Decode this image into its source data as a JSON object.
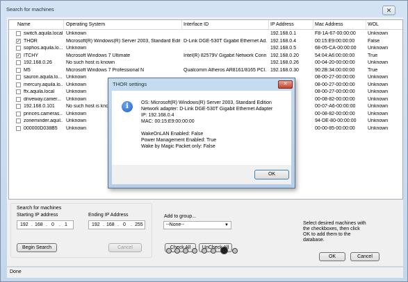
{
  "window": {
    "title": "Search for machines",
    "close_glyph": "✕"
  },
  "columns": [
    "Name",
    "Operating System",
    "Interface ID",
    "IP Address",
    "Mac Address",
    "WOL"
  ],
  "rows": [
    {
      "checked": false,
      "name": "switch.aquila.local",
      "os": "Unknown",
      "iface": "",
      "ip": "192.168.0.1",
      "mac": "F8-1A-67-00:00:00",
      "wol": "Unknown"
    },
    {
      "checked": true,
      "name": "THOR",
      "os": "Microsoft(R) Windows(R) Server 2003, Standard Edit...",
      "iface": "D-Link DGE-530T Gigabit Ethernet Ad...",
      "ip": "192.168.0.4",
      "mac": "00:15:E9:00:00:00",
      "wol": "False"
    },
    {
      "checked": false,
      "name": "sophos.aquila.lo...",
      "os": "Unknown",
      "iface": "",
      "ip": "192.168.0.5",
      "mac": "68-05-CA-00:00:00",
      "wol": "Unknown"
    },
    {
      "checked": true,
      "name": "ITCHY",
      "os": "Microsoft Windows 7 Ultimate",
      "iface": "Intel(R) 82579V Gigabit Network Conn...",
      "ip": "192.168.0.20",
      "mac": "54:04:A6:00:00:00",
      "wol": "True"
    },
    {
      "checked": false,
      "name": "192.168.0.26",
      "os": "No such host is known",
      "iface": "",
      "ip": "192.168.0.26",
      "mac": "00-04-20-00:00:00",
      "wol": "Unknown"
    },
    {
      "checked": false,
      "name": "M5",
      "os": "Microsoft Windows 7 Professional N",
      "iface": "Qualcomm Atheros AR8161/8165 PCI...",
      "ip": "192.168.0.30",
      "mac": "90:2B:34:00:00:00",
      "wol": "True"
    },
    {
      "checked": false,
      "name": "sauron.aquila.lo...",
      "os": "Unknown",
      "iface": "",
      "ip": "",
      "mac": "08-00-27-00:00:00",
      "wol": "Unknown"
    },
    {
      "checked": false,
      "name": "mercury.aquila.lo...",
      "os": "Unknown",
      "iface": "",
      "ip": "",
      "mac": "08-00-27-00:00:00",
      "wol": "Unknown"
    },
    {
      "checked": false,
      "name": "ffx.aquila.local",
      "os": "Unknown",
      "iface": "",
      "ip": "",
      "mac": "08-00-27-00:00:00",
      "wol": "Unknown"
    },
    {
      "checked": false,
      "name": "driveway.camer...",
      "os": "Unknown",
      "iface": "",
      "ip": "",
      "mac": "00-08-82-00:00:00",
      "wol": "Unknown"
    },
    {
      "checked": false,
      "name": "192.168.0.101",
      "os": "No such host is known",
      "iface": "",
      "ip": "",
      "mac": "00-07-A6-00:00:00",
      "wol": "Unknown"
    },
    {
      "checked": false,
      "name": "princes.cameras...",
      "os": "Unknown",
      "iface": "",
      "ip": "",
      "mac": "00-08-82-00:00:00",
      "wol": "Unknown"
    },
    {
      "checked": false,
      "name": "zoneminder.aquil...",
      "os": "Unknown",
      "iface": "",
      "ip": "",
      "mac": "94-DE-80-00:00:00",
      "wol": "Unknown"
    },
    {
      "checked": false,
      "name": "000000D038B5",
      "os": "Unknown",
      "iface": "",
      "ip": "",
      "mac": "00-00-85-00:00:00",
      "wol": "Unknown"
    }
  ],
  "search": {
    "group_label": "Search for machines",
    "start_label": "Starting IP address",
    "end_label": "Ending IP Address",
    "start_octets": [
      "192",
      "168",
      "0",
      "1"
    ],
    "end_octets": [
      "192",
      "168",
      "0",
      "255"
    ],
    "begin_label": "Begin Search",
    "cancel_label": "Cancel"
  },
  "group": {
    "label": "Add to group...",
    "value": "--None--"
  },
  "select": {
    "check_all": "Check All",
    "uncheck_all": "UnCheck All"
  },
  "hint": "Select desired machines with the checkboxes, then click OK to add them to the database.",
  "ok_label": "OK",
  "cancel_label": "Cancel",
  "status": "Done",
  "dialog": {
    "title": "THOR settings",
    "icon": "information-icon",
    "os": "OS: Microsoft(R) Windows(R) Server 2003, Standard Edition",
    "adapter": "Network adapter: D-Link DGE-530T Gigabit Ethernet Adapter",
    "ip": "IP: 192.168.0.4",
    "mac": "MAC: 00:15:E9:00:00:00",
    "wol": "WakeOnLAN Enabled: False",
    "pm": "Power Management Enabled: True",
    "magic": "Wake by Magic Packet only: False",
    "ok": "OK"
  },
  "colors": {
    "accent": "#1f5fbf",
    "window": "#c3d6ec"
  }
}
